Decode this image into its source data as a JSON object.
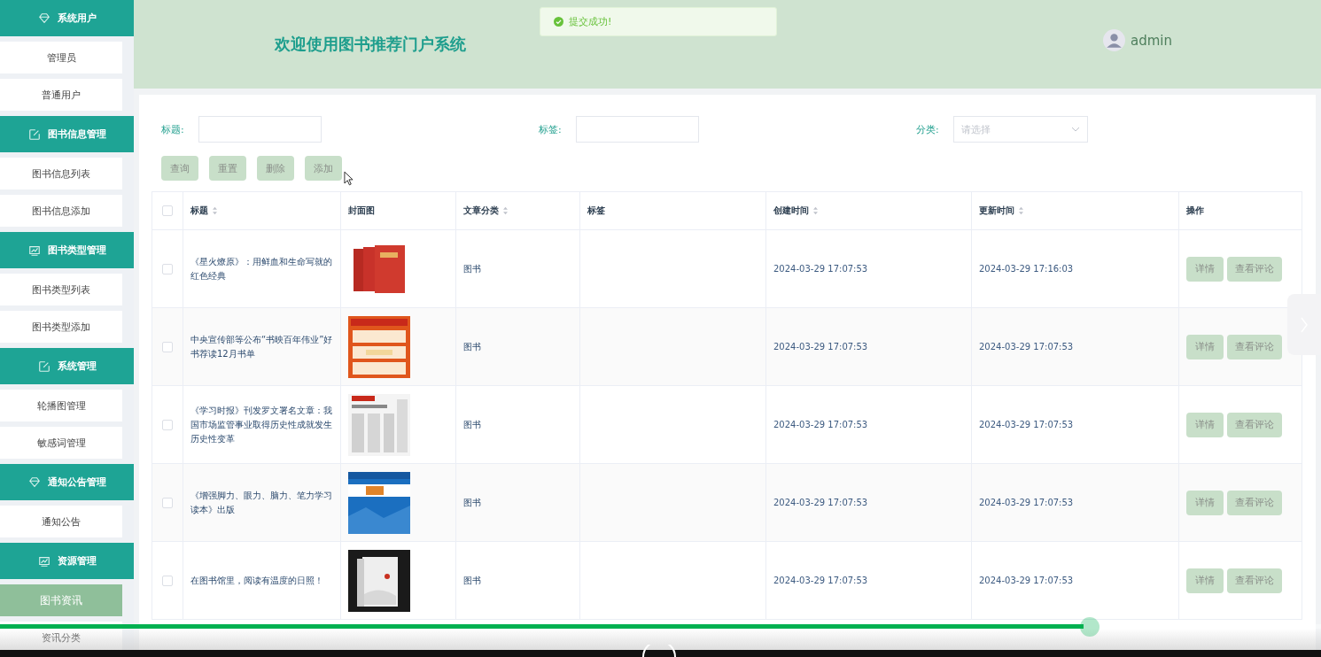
{
  "sidebar": {
    "groups": [
      {
        "label": "系统用户",
        "kind": "diamond",
        "items": [
          {
            "label": "管理员",
            "selected": false
          },
          {
            "label": "普通用户",
            "selected": false
          }
        ]
      },
      {
        "label": "图书信息管理",
        "kind": "edit",
        "items": [
          {
            "label": "图书信息列表",
            "selected": false
          },
          {
            "label": "图书信息添加",
            "selected": false
          }
        ]
      },
      {
        "label": "图书类型管理",
        "kind": "chart",
        "items": [
          {
            "label": "图书类型列表",
            "selected": false
          },
          {
            "label": "图书类型添加",
            "selected": false
          }
        ]
      },
      {
        "label": "系统管理",
        "kind": "edit",
        "items": [
          {
            "label": "轮播图管理",
            "selected": false
          },
          {
            "label": "敏感词管理",
            "selected": false
          }
        ]
      },
      {
        "label": "通知公告管理",
        "kind": "diamond",
        "items": [
          {
            "label": "通知公告",
            "selected": false
          }
        ]
      },
      {
        "label": "资源管理",
        "kind": "chart",
        "items": [
          {
            "label": "图书资讯",
            "selected": true
          },
          {
            "label": "资讯分类",
            "selected": false
          }
        ]
      }
    ]
  },
  "header": {
    "title": "欢迎使用图书推荐门户系统",
    "toast": "提交成功!",
    "user": "admin"
  },
  "filters": {
    "fields": [
      {
        "label": "标题:"
      },
      {
        "label": "标签:"
      }
    ],
    "select": {
      "label": "分类:",
      "placeholder": "请选择"
    }
  },
  "buttons": [
    "查询",
    "重置",
    "删除",
    "添加"
  ],
  "table": {
    "header_checked": false,
    "columns": [
      {
        "label": "标题",
        "sortable": true
      },
      {
        "label": "封面图",
        "sortable": false
      },
      {
        "label": "文章分类",
        "sortable": true
      },
      {
        "label": "标签",
        "sortable": false
      },
      {
        "label": "创建时间",
        "sortable": true
      },
      {
        "label": "更新时间",
        "sortable": true
      },
      {
        "label": "操作",
        "sortable": false
      }
    ],
    "rows": [
      {
        "checked": false,
        "title": "《星火燎原》：用鲜血和生命写就的红色经典",
        "category": "图书",
        "created": "2024-03-29 17:07:53",
        "updated": "2024-03-29 17:16:03",
        "actions": [
          "详情",
          "查看评论"
        ]
      },
      {
        "checked": false,
        "title": "中央宣传部等公布“书映百年伟业”好书荐读12月书单",
        "category": "图书",
        "created": "2024-03-29 17:07:53",
        "updated": "2024-03-29 17:07:53",
        "actions": [
          "详情",
          "查看评论"
        ]
      },
      {
        "checked": false,
        "title": "《学习时报》刊发罗文署名文章：我国市场监管事业取得历史性成就发生历史性变革",
        "category": "图书",
        "created": "2024-03-29 17:07:53",
        "updated": "2024-03-29 17:07:53",
        "actions": [
          "详情",
          "查看评论"
        ]
      },
      {
        "checked": false,
        "title": "《增强脚力、眼力、脑力、笔力学习读本》出版",
        "category": "图书",
        "created": "2024-03-29 17:07:53",
        "updated": "2024-03-29 17:07:53",
        "actions": [
          "详情",
          "查看评论"
        ]
      },
      {
        "checked": false,
        "title": "在图书馆里，阅读有温度的日照！",
        "category": "图书",
        "created": "2024-03-29 17:07:53",
        "updated": "2024-03-29 17:07:53",
        "actions": [
          "详情",
          "查看评论"
        ]
      }
    ]
  },
  "player": {
    "level": 0.82
  }
}
